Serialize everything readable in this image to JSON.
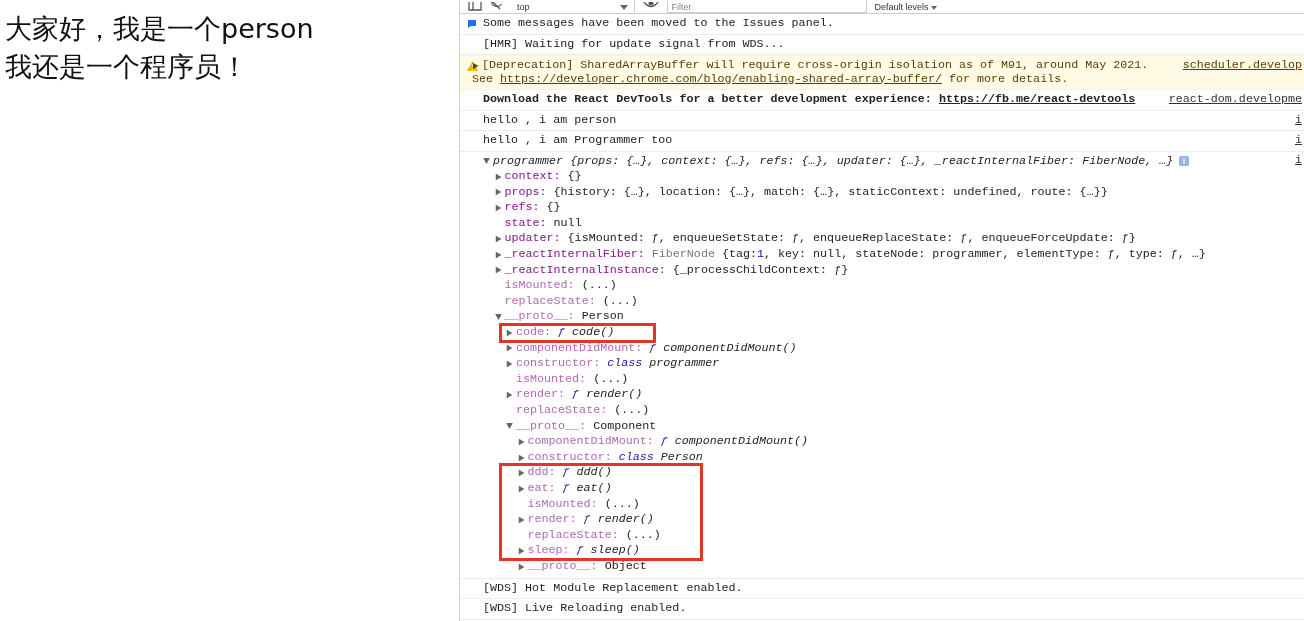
{
  "page": {
    "lines": [
      "大家好，我是一个person",
      "我还是一个程序员！"
    ]
  },
  "toolbar": {
    "context": "top",
    "filter_placeholder": "Filter",
    "levels": "Default levels"
  },
  "messages": [
    {
      "kind": "info",
      "text": "Some messages have been moved to the Issues panel."
    },
    {
      "kind": "log",
      "text": "[HMR] Waiting for update signal from WDS..."
    },
    {
      "kind": "warning",
      "expanded": false,
      "text": "[Deprecation] SharedArrayBuffer will require cross-origin isolation as of M91, around May 2021.",
      "see": "See",
      "link": "https://developer.chrome.com/blog/enabling-shared-array-buffer/",
      "after": "for more details.",
      "source": "scheduler.develop"
    },
    {
      "kind": "bold",
      "text": "Download the React DevTools for a better development experience:",
      "link": "https://fb.me/react-devtools",
      "source": "react-dom.developme"
    },
    {
      "kind": "log",
      "text": "hello , i am person",
      "source": "i"
    },
    {
      "kind": "log",
      "text": "hello , i am Programmer too",
      "source": "i"
    },
    {
      "kind": "object",
      "source": "i",
      "tree": {
        "expandable": true,
        "expanded": true,
        "info": true,
        "value": [
          {
            "kind": "italic",
            "text": "programmer {props: {…}, context: {…}, refs: {…}, updater: {…}, _reactInternalFiber: FiberNode, …}"
          }
        ],
        "children": [
          {
            "key": "context:",
            "dim": false,
            "expandable": true,
            "expanded": false,
            "value": [
              {
                "kind": "plain",
                "text": "{}"
              }
            ]
          },
          {
            "key": "props:",
            "dim": false,
            "expandable": true,
            "expanded": false,
            "value": [
              {
                "kind": "plain",
                "text": "{history: {…}, location: {…}, match: {…}, staticContext: undefined, route: {…}}"
              }
            ]
          },
          {
            "key": "refs:",
            "dim": false,
            "expandable": true,
            "expanded": false,
            "value": [
              {
                "kind": "plain",
                "text": "{}"
              }
            ]
          },
          {
            "key": "state:",
            "dim": false,
            "expandable": false,
            "value": [
              {
                "kind": "plain",
                "text": "null"
              }
            ]
          },
          {
            "key": "updater:",
            "dim": false,
            "expandable": true,
            "expanded": false,
            "value": [
              {
                "kind": "plain",
                "text": "{isMounted: ƒ, enqueueSetState: ƒ, enqueueReplaceState: ƒ, enqueueForceUpdate: ƒ}"
              }
            ]
          },
          {
            "key": "_reactInternalFiber:",
            "dim": false,
            "expandable": true,
            "expanded": false,
            "value": [
              {
                "kind": "gray",
                "text": "FiberNode"
              },
              {
                "kind": "plain",
                "text": "{tag:"
              },
              {
                "kind": "number",
                "text": "1"
              },
              {
                "kind": "plain",
                "text": ", key: null, stateNode: programmer, elementType: ƒ, type: ƒ, …}"
              }
            ]
          },
          {
            "key": "_reactInternalInstance:",
            "dim": false,
            "expandable": true,
            "expanded": false,
            "value": [
              {
                "kind": "plain",
                "text": "{_processChildContext: ƒ}"
              }
            ]
          },
          {
            "key": "isMounted:",
            "dim": true,
            "expandable": false,
            "value": [
              {
                "kind": "plain",
                "text": "(...)"
              }
            ]
          },
          {
            "key": "replaceState:",
            "dim": true,
            "expandable": false,
            "value": [
              {
                "kind": "plain",
                "text": "(...)"
              }
            ]
          },
          {
            "key": "__proto__:",
            "dim": true,
            "expandable": true,
            "expanded": true,
            "value": [
              {
                "kind": "plain",
                "text": "Person"
              }
            ],
            "children": [
              {
                "key": "code:",
                "dim": true,
                "expandable": true,
                "expanded": false,
                "highlighted": true,
                "value": [
                  {
                    "kind": "keyword",
                    "text": "ƒ"
                  },
                  {
                    "kind": "italic",
                    "text": "code()"
                  }
                ]
              },
              {
                "key": "componentDidMount:",
                "dim": true,
                "expandable": true,
                "expanded": false,
                "value": [
                  {
                    "kind": "keyword",
                    "text": "ƒ"
                  },
                  {
                    "kind": "italic",
                    "text": "componentDidMount()"
                  }
                ]
              },
              {
                "key": "constructor:",
                "dim": true,
                "expandable": true,
                "expanded": false,
                "value": [
                  {
                    "kind": "keyword",
                    "text": "class"
                  },
                  {
                    "kind": "italic",
                    "text": "programmer"
                  }
                ]
              },
              {
                "key": "isMounted:",
                "dim": true,
                "expandable": false,
                "value": [
                  {
                    "kind": "plain",
                    "text": "(...)"
                  }
                ]
              },
              {
                "key": "render:",
                "dim": true,
                "expandable": true,
                "expanded": false,
                "value": [
                  {
                    "kind": "keyword",
                    "text": "ƒ"
                  },
                  {
                    "kind": "italic",
                    "text": "render()"
                  }
                ]
              },
              {
                "key": "replaceState:",
                "dim": true,
                "expandable": false,
                "value": [
                  {
                    "kind": "plain",
                    "text": "(...)"
                  }
                ]
              },
              {
                "key": "__proto__:",
                "dim": true,
                "expandable": true,
                "expanded": true,
                "value": [
                  {
                    "kind": "plain",
                    "text": "Component"
                  }
                ],
                "children": [
                  {
                    "key": "componentDidMount:",
                    "dim": true,
                    "expandable": true,
                    "expanded": false,
                    "value": [
                      {
                        "kind": "keyword",
                        "text": "ƒ"
                      },
                      {
                        "kind": "italic",
                        "text": "componentDidMount()"
                      }
                    ]
                  },
                  {
                    "key": "constructor:",
                    "dim": true,
                    "expandable": true,
                    "expanded": false,
                    "value": [
                      {
                        "kind": "keyword",
                        "text": "class"
                      },
                      {
                        "kind": "italic",
                        "text": "Person"
                      }
                    ]
                  },
                  {
                    "key": "ddd:",
                    "dim": true,
                    "expandable": true,
                    "expanded": false,
                    "highlighted": true,
                    "value": [
                      {
                        "kind": "keyword",
                        "text": "ƒ"
                      },
                      {
                        "kind": "italic",
                        "text": "ddd()"
                      }
                    ]
                  },
                  {
                    "key": "eat:",
                    "dim": true,
                    "expandable": true,
                    "expanded": false,
                    "highlighted": true,
                    "value": [
                      {
                        "kind": "keyword",
                        "text": "ƒ"
                      },
                      {
                        "kind": "italic",
                        "text": "eat()"
                      }
                    ]
                  },
                  {
                    "key": "isMounted:",
                    "dim": true,
                    "expandable": false,
                    "highlighted": true,
                    "value": [
                      {
                        "kind": "plain",
                        "text": "(...)"
                      }
                    ]
                  },
                  {
                    "key": "render:",
                    "dim": true,
                    "expandable": true,
                    "expanded": false,
                    "highlighted": true,
                    "value": [
                      {
                        "kind": "keyword",
                        "text": "ƒ"
                      },
                      {
                        "kind": "italic",
                        "text": "render()"
                      }
                    ]
                  },
                  {
                    "key": "replaceState:",
                    "dim": true,
                    "expandable": false,
                    "highlighted": true,
                    "value": [
                      {
                        "kind": "plain",
                        "text": "(...)"
                      }
                    ]
                  },
                  {
                    "key": "sleep:",
                    "dim": true,
                    "expandable": true,
                    "expanded": false,
                    "highlighted": true,
                    "value": [
                      {
                        "kind": "keyword",
                        "text": "ƒ"
                      },
                      {
                        "kind": "italic",
                        "text": "sleep()"
                      }
                    ]
                  },
                  {
                    "key": "__proto__:",
                    "dim": true,
                    "expandable": true,
                    "expanded": false,
                    "value": [
                      {
                        "kind": "plain",
                        "text": "Object"
                      }
                    ]
                  }
                ]
              }
            ]
          }
        ]
      }
    },
    {
      "kind": "log",
      "text": "[WDS] Hot Module Replacement enabled."
    },
    {
      "kind": "log",
      "text": "[WDS] Live Reloading enabled."
    }
  ]
}
